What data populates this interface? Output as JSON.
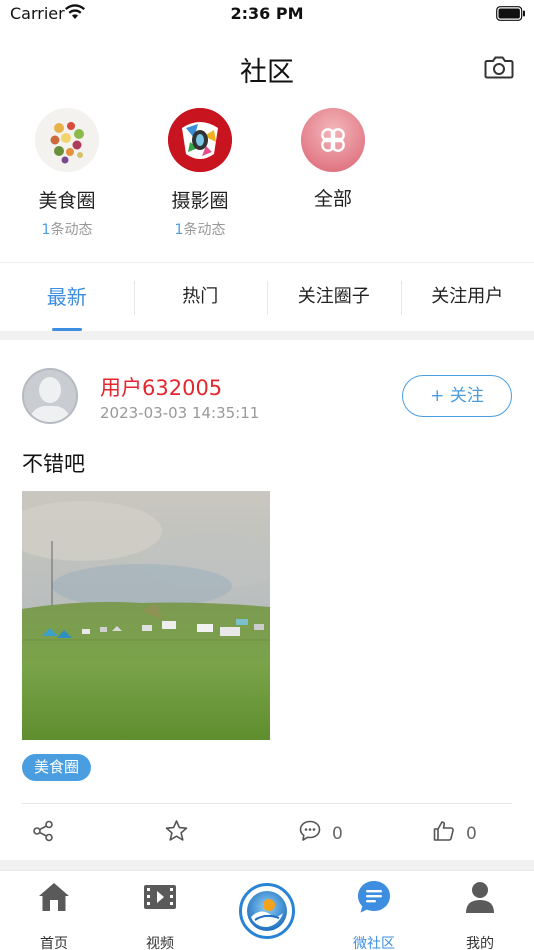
{
  "status_bar": {
    "carrier": "Carrier",
    "time": "2:36 PM"
  },
  "header": {
    "title": "社区",
    "camera_icon": "camera-icon"
  },
  "circles": [
    {
      "name": "美食圈",
      "count": "1",
      "count_suffix": "条动态",
      "icon": "food-collage"
    },
    {
      "name": "摄影圈",
      "count": "1",
      "count_suffix": "条动态",
      "icon": "camera-logo"
    },
    {
      "name": "全部",
      "icon": "clover-icon"
    }
  ],
  "tabs": [
    {
      "label": "最新",
      "active": true
    },
    {
      "label": "热门",
      "active": false
    },
    {
      "label": "关注圈子",
      "active": false
    },
    {
      "label": "关注用户",
      "active": false
    }
  ],
  "post": {
    "user_name": "用户632005",
    "time": "2023-03-03 14:35:11",
    "follow_label": "+ 关注",
    "text": "不错吧",
    "tag": "美食圈",
    "actions": {
      "comments": "0",
      "likes": "0"
    }
  },
  "tabbar": [
    {
      "label": "首页",
      "icon": "home-icon",
      "active": false
    },
    {
      "label": "视频",
      "icon": "video-icon",
      "active": false
    },
    {
      "label": "",
      "icon": "center-logo",
      "active": false
    },
    {
      "label": "微社区",
      "icon": "community-icon",
      "active": true
    },
    {
      "label": "我的",
      "icon": "profile-icon",
      "active": false
    }
  ],
  "colors": {
    "accent": "#3d8ee0",
    "username": "#e4272f",
    "tag_bg": "#4a9ee0"
  }
}
